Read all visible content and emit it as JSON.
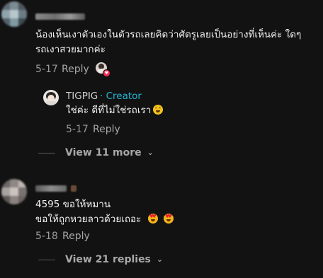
{
  "comments": [
    {
      "text_line1": "น้องเห็นเงาตัวเองในตัวรถเลยคิดว่าศัตรูเลยเป็นอย่างที่เห็นค่ะ ใดๆ",
      "text_line2": "รถเงาสวยมากค่ะ",
      "date": "5-17",
      "reply_label": "Reply",
      "reply": {
        "author": "TIGPIG",
        "creator_label": "· Creator",
        "text": "ใช่ค่ะ ดีที่ไม่ใช่รถเรา",
        "emoji": "laughing-emoji",
        "date": "5-17",
        "reply_label": "Reply"
      },
      "view_more": "View 11 more"
    },
    {
      "text_line1": "4595 ขอให้หมาน",
      "text_line2": "ขอให้ถูกหวยลาวด้วยเถอะ",
      "emoji": "heart-eyes-emoji",
      "date": "5-18",
      "reply_label": "Reply",
      "view_more": "View 21 replies"
    }
  ],
  "colors": {
    "background": "#121212",
    "creator": "#20b8d6",
    "muted": "#a8a8a8",
    "like_heart": "#fe2c55"
  }
}
